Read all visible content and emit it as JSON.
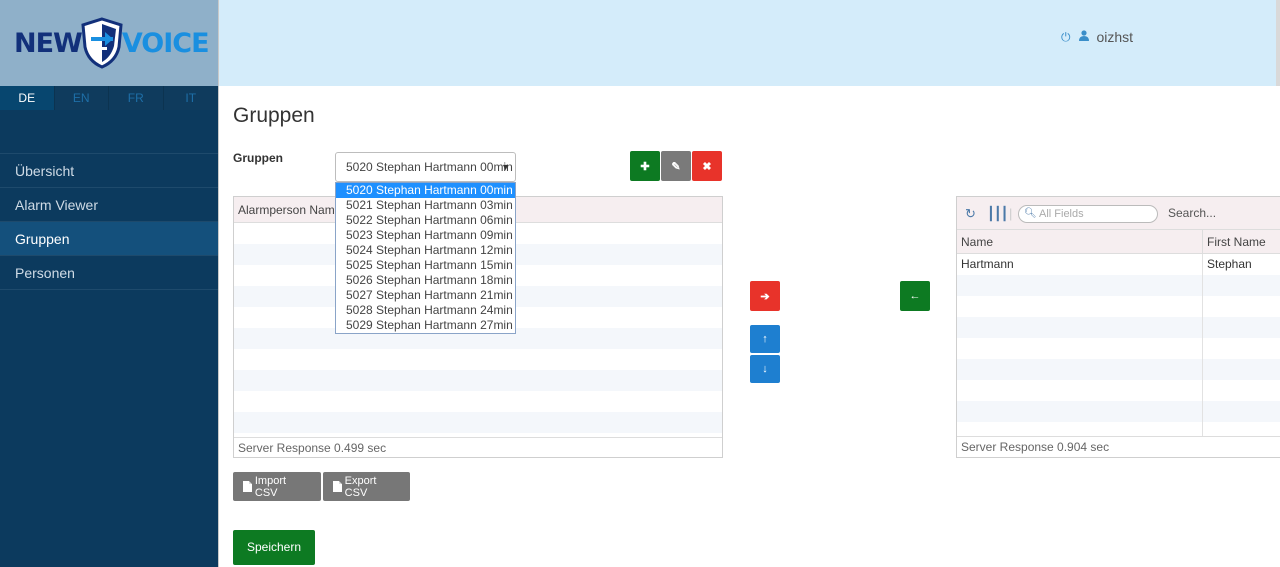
{
  "logo": {
    "part1": "NEW",
    "part2": "VOICE"
  },
  "languages": [
    "DE",
    "EN",
    "FR",
    "IT"
  ],
  "nav": [
    "Übersicht",
    "Alarm Viewer",
    "Gruppen",
    "Personen"
  ],
  "user": {
    "name": "oizhst"
  },
  "page": {
    "title": "Gruppen",
    "field_label": "Gruppen"
  },
  "select": {
    "value": "5020 Stephan Hartmann 00min",
    "options": [
      "5020 Stephan Hartmann 00min",
      "5021 Stephan Hartmann 03min",
      "5022 Stephan Hartmann 06min",
      "5023 Stephan Hartmann 09min",
      "5024 Stephan Hartmann 12min",
      "5025 Stephan Hartmann 15min",
      "5026 Stephan Hartmann 18min",
      "5027 Stephan Hartmann 21min",
      "5028 Stephan Hartmann 24min",
      "5029 Stephan Hartmann 27min"
    ]
  },
  "left_grid": {
    "header": "Alarmperson Name",
    "footer": "Server Response 0.499 sec"
  },
  "right_grid": {
    "search_placeholder": "All Fields",
    "search_label": "Search...",
    "columns": [
      "Name",
      "First Name"
    ],
    "rows": [
      [
        "Hartmann",
        "Stephan"
      ]
    ],
    "footer": "Server Response 0.904 sec"
  },
  "buttons": {
    "import": "Import CSV",
    "export": "Export CSV",
    "save": "Speichern"
  },
  "colors": {
    "sidebar": "#0c3a5e",
    "header": "#d4ecfa",
    "green": "#0d7a22",
    "red": "#e8332a",
    "blue": "#1e7fd0"
  }
}
